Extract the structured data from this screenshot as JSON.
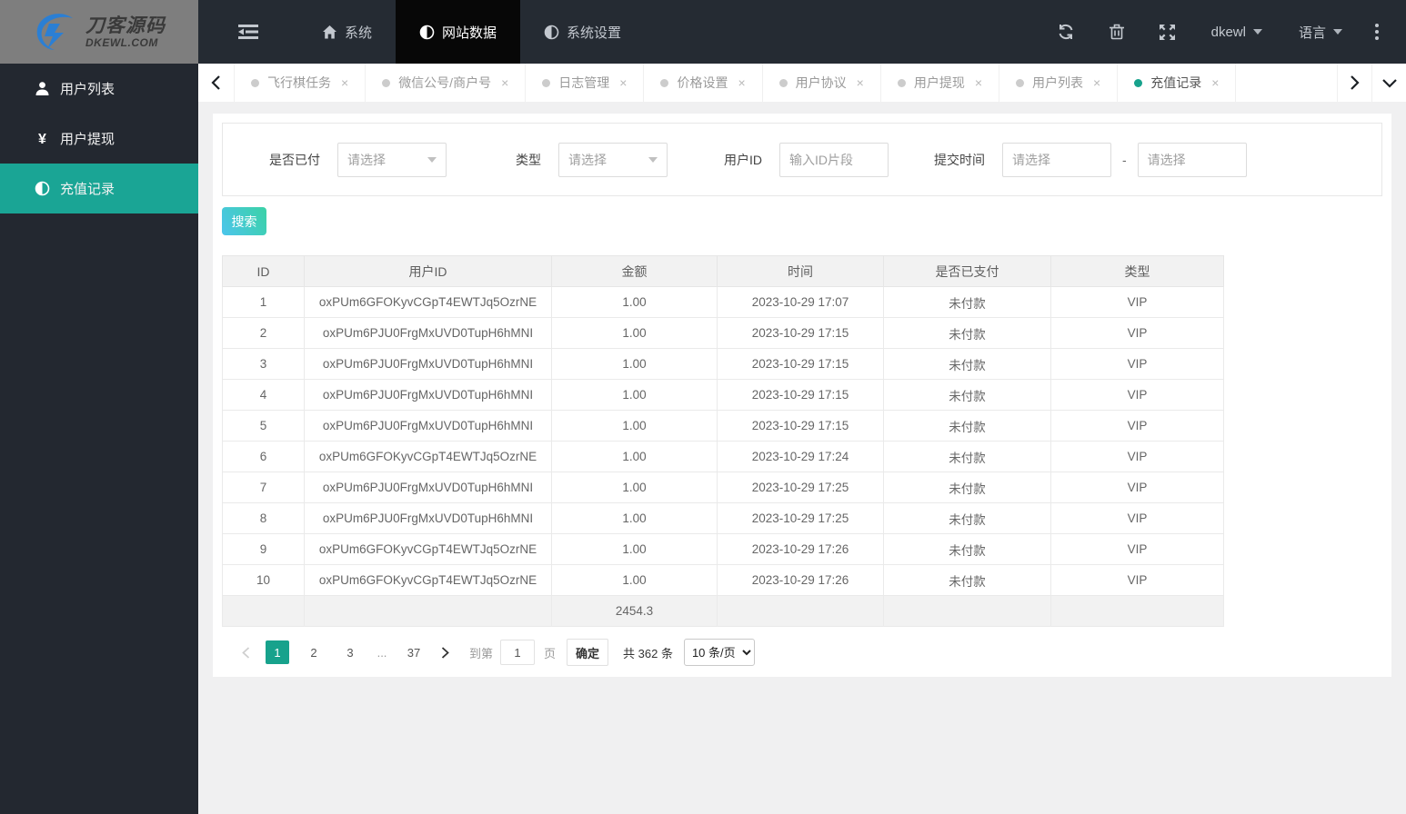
{
  "logo": {
    "title_cn": "刀客源码",
    "title_en": "DKEWL.COM"
  },
  "topnav": {
    "items": [
      {
        "label": "系统",
        "icon": "home-icon",
        "active": false
      },
      {
        "label": "网站数据",
        "icon": "half-circle-icon",
        "active": true
      },
      {
        "label": "系统设置",
        "icon": "half-circle-icon",
        "active": false
      }
    ],
    "username": "dkewl",
    "language_label": "语言"
  },
  "tabs": [
    {
      "label": "飞行棋任务",
      "active": false
    },
    {
      "label": "微信公号/商户号",
      "active": false
    },
    {
      "label": "日志管理",
      "active": false
    },
    {
      "label": "价格设置",
      "active": false
    },
    {
      "label": "用户协议",
      "active": false
    },
    {
      "label": "用户提现",
      "active": false
    },
    {
      "label": "用户列表",
      "active": false
    },
    {
      "label": "充值记录",
      "active": true
    }
  ],
  "sidebar": {
    "items": [
      {
        "label": "用户列表",
        "icon": "user-icon",
        "active": false
      },
      {
        "label": "用户提现",
        "icon": "yen-icon",
        "active": false
      },
      {
        "label": "充值记录",
        "icon": "half-circle-icon",
        "active": true
      }
    ]
  },
  "filters": {
    "paid_label": "是否已付",
    "paid_placeholder": "请选择",
    "type_label": "类型",
    "type_placeholder": "请选择",
    "userid_label": "用户ID",
    "userid_placeholder": "输入ID片段",
    "time_label": "提交时间",
    "time_from_placeholder": "请选择",
    "time_to_placeholder": "请选择",
    "separator": "-",
    "search_label": "搜索"
  },
  "table": {
    "columns": [
      "ID",
      "用户ID",
      "金额",
      "时间",
      "是否已支付",
      "类型"
    ],
    "rows": [
      [
        "1",
        "oxPUm6GFOKyvCGpT4EWTJq5OzrNE",
        "1.00",
        "2023-10-29 17:07",
        "未付款",
        "VIP"
      ],
      [
        "2",
        "oxPUm6PJU0FrgMxUVD0TupH6hMNI",
        "1.00",
        "2023-10-29 17:15",
        "未付款",
        "VIP"
      ],
      [
        "3",
        "oxPUm6PJU0FrgMxUVD0TupH6hMNI",
        "1.00",
        "2023-10-29 17:15",
        "未付款",
        "VIP"
      ],
      [
        "4",
        "oxPUm6PJU0FrgMxUVD0TupH6hMNI",
        "1.00",
        "2023-10-29 17:15",
        "未付款",
        "VIP"
      ],
      [
        "5",
        "oxPUm6PJU0FrgMxUVD0TupH6hMNI",
        "1.00",
        "2023-10-29 17:15",
        "未付款",
        "VIP"
      ],
      [
        "6",
        "oxPUm6GFOKyvCGpT4EWTJq5OzrNE",
        "1.00",
        "2023-10-29 17:24",
        "未付款",
        "VIP"
      ],
      [
        "7",
        "oxPUm6PJU0FrgMxUVD0TupH6hMNI",
        "1.00",
        "2023-10-29 17:25",
        "未付款",
        "VIP"
      ],
      [
        "8",
        "oxPUm6PJU0FrgMxUVD0TupH6hMNI",
        "1.00",
        "2023-10-29 17:25",
        "未付款",
        "VIP"
      ],
      [
        "9",
        "oxPUm6GFOKyvCGpT4EWTJq5OzrNE",
        "1.00",
        "2023-10-29 17:26",
        "未付款",
        "VIP"
      ],
      [
        "10",
        "oxPUm6GFOKyvCGpT4EWTJq5OzrNE",
        "1.00",
        "2023-10-29 17:26",
        "未付款",
        "VIP"
      ]
    ],
    "summary": [
      "",
      "",
      "2454.3",
      "",
      "",
      ""
    ]
  },
  "pagination": {
    "pages": [
      "1",
      "2",
      "3",
      "...",
      "37"
    ],
    "active_page": "1",
    "goto_label": "到第",
    "goto_value": "1",
    "page_label": "页",
    "confirm_label": "确定",
    "total_label": "共 362 条",
    "per_page": "10 条/页"
  },
  "colors": {
    "accent": "#17a28c",
    "sidebar_bg": "#232830",
    "header_bg": "#252b33",
    "active_nav_bg": "#070707",
    "search_gradient_from": "#4cc5ec",
    "search_gradient_to": "#3bd2a6"
  }
}
